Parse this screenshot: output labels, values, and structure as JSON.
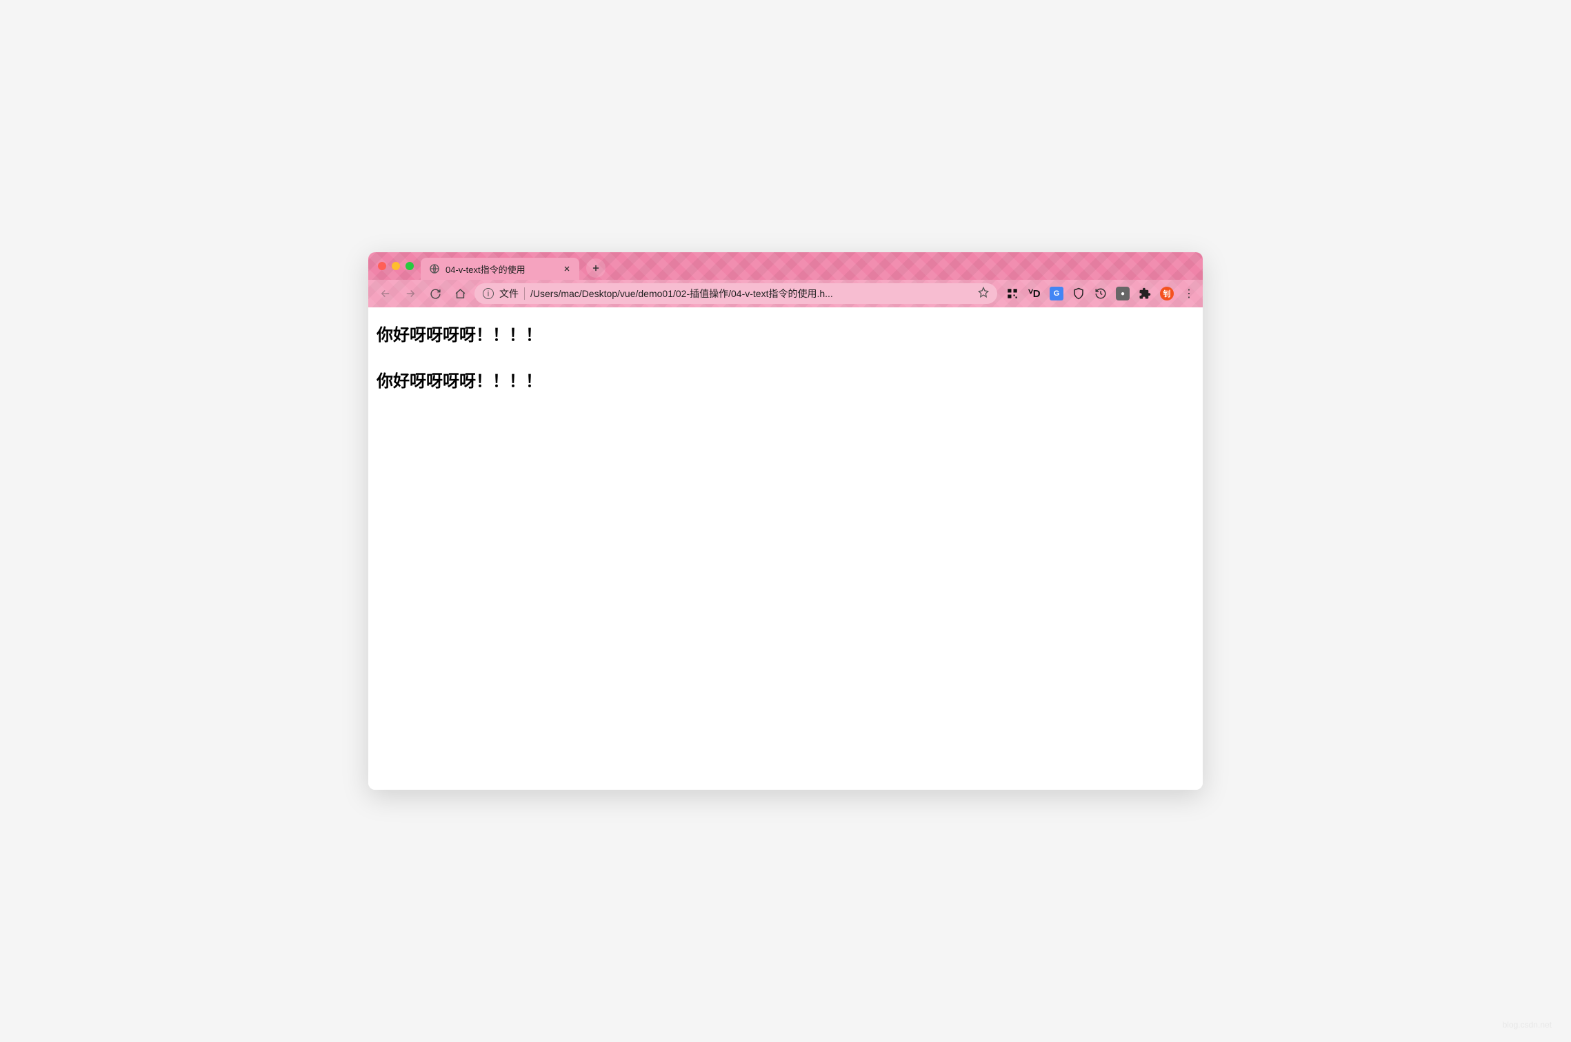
{
  "tab": {
    "title": "04-v-text指令的使用"
  },
  "addressbar": {
    "scheme_label": "文件",
    "path": "/Users/mac/Desktop/vue/demo01/02-插值操作/04-v-text指令的使用.h..."
  },
  "extensions": {
    "avatar_label": "钊"
  },
  "page": {
    "heading1": "你好呀呀呀呀！！！！",
    "heading2": "你好呀呀呀呀！！！！"
  },
  "watermark": "blog.csdn.net"
}
